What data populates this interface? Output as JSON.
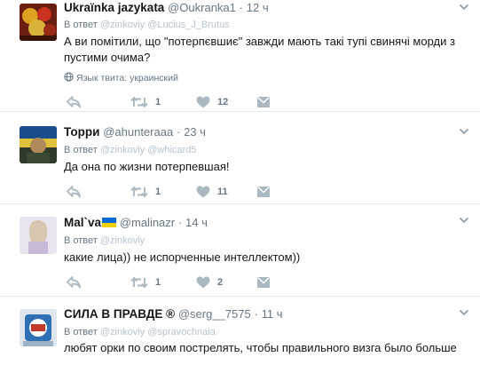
{
  "colors": {
    "muted": "#657786",
    "icon": "#aab8c2",
    "divider": "#e1e8ed",
    "link_faded": "#b6c4d0"
  },
  "icons": {
    "reply": "reply-icon",
    "retweet": "retweet-icon",
    "like": "heart-icon",
    "dm": "envelope-icon",
    "menu": "chevron-down-icon",
    "language": "globe-icon"
  },
  "tweets": [
    {
      "name": "Ukraïnka jazykata",
      "handle": "@Oukranka1",
      "dot": "·",
      "time": "12 ч",
      "reply_prefix": "В ответ",
      "mentions": "@zinkoviy @Lucius_J_Brutus",
      "text": "А ви помітили, що \"потерпєвшиє\" завжди мають такі тупі свинячі морди з пустими очима?",
      "lang_note": "Язык твита: украинский",
      "retweets": "1",
      "likes": "12"
    },
    {
      "name": "Торри",
      "handle": "@ahunteraaa",
      "dot": "·",
      "time": "23 ч",
      "reply_prefix": "В ответ",
      "mentions": "@zinkoviy @whicard5",
      "text": "Да она по жизни потерпевшая!",
      "retweets": "1",
      "likes": "11"
    },
    {
      "name": "Mal`va",
      "handle": "@malinazr",
      "dot": "·",
      "time": "14 ч",
      "reply_prefix": "В ответ",
      "mentions": "@zinkoviy",
      "text": "какие лица)) не испорченные интеллектом))",
      "retweets": "1",
      "likes": "2"
    },
    {
      "name": "СИЛА В ПРАВДЕ ®",
      "handle": "@serg__7575",
      "dot": "·",
      "time": "11 ч",
      "reply_prefix": "В ответ",
      "mentions": "@zinkoviy @spravochnaia",
      "text": "любят орки по своим пострелять, чтобы правильного визга было больше"
    }
  ]
}
